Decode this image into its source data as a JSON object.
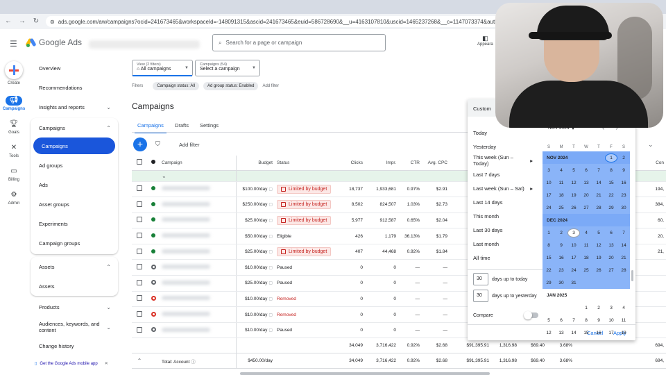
{
  "browser": {
    "url": "ads.google.com/aw/campaigns?ocid=241673465&workspaceId=-148091315&ascid=241673465&euid=586728690&__u=4163107810&uscid=1465237268&__c=1147073374&authuser=0&subid="
  },
  "app": {
    "name": "Google Ads",
    "search_placeholder": "Search for a page or campaign",
    "appearance_label": "Appeara"
  },
  "rail": {
    "create": "Create",
    "campaigns": "Campaigns",
    "goals": "Goals",
    "tools": "Tools",
    "billing": "Billing",
    "admin": "Admin"
  },
  "sidenav": {
    "overview": "Overview",
    "recommendations": "Recommendations",
    "insights": "Insights and reports",
    "campaigns_section": "Campaigns",
    "campaigns": "Campaigns",
    "ad_groups": "Ad groups",
    "ads": "Ads",
    "asset_groups": "Asset groups",
    "experiments": "Experiments",
    "campaign_groups": "Campaign groups",
    "assets_section": "Assets",
    "assets": "Assets",
    "products": "Products",
    "audiences": "Audiences, keywords, and content",
    "change_history": "Change history",
    "mobile_app": "Get the Google Ads mobile app"
  },
  "toolbar": {
    "view_sub": "View (2 filters)",
    "view_label": "All campaigns",
    "campaigns_sub": "Campaigns (54)",
    "campaigns_label": "Select a campaign",
    "filters_label": "Filters",
    "chip1": "Campaign status: All",
    "chip2": "Ad group status: Enabled",
    "add_filter_small": "Add filter",
    "page_title": "Campaigns",
    "tabs": [
      "Campaigns",
      "Drafts",
      "Settings"
    ],
    "add_filter": "Add filter"
  },
  "table": {
    "headers": {
      "campaign": "Campaign",
      "budget": "Budget",
      "status": "Status",
      "clicks": "Clicks",
      "impr": "Impr.",
      "ctr": "CTR",
      "avg_cpc": "Avg. CPC",
      "conv": "Con"
    },
    "rows": [
      {
        "state": "enabled",
        "budget": "$100.00/day",
        "status": "Limited by budget",
        "clicks": "18,737",
        "impr": "1,933,681",
        "ctr": "0.97%",
        "cpc": "$2.91",
        "right": "194,"
      },
      {
        "state": "enabled",
        "budget": "$250.00/day",
        "status": "Limited by budget",
        "clicks": "8,502",
        "impr": "824,507",
        "ctr": "1.03%",
        "cpc": "$2.73",
        "right": "384,"
      },
      {
        "state": "enabled",
        "budget": "$25.00/day",
        "status": "Limited by budget",
        "clicks": "5,977",
        "impr": "912,587",
        "ctr": "0.65%",
        "cpc": "$2.04",
        "right": "60,"
      },
      {
        "state": "enabled",
        "budget": "$50.00/day",
        "status": "Eligible",
        "clicks": "426",
        "impr": "1,179",
        "ctr": "36.13%",
        "cpc": "$1.79",
        "right": "20,"
      },
      {
        "state": "enabled",
        "budget": "$25.00/day",
        "status": "Limited by budget",
        "clicks": "407",
        "impr": "44,468",
        "ctr": "0.92%",
        "cpc": "$1.84",
        "right": "21,"
      },
      {
        "state": "paused",
        "budget": "$10.00/day",
        "status": "Paused",
        "clicks": "0",
        "impr": "0",
        "ctr": "—",
        "cpc": "—",
        "right": ""
      },
      {
        "state": "paused",
        "budget": "$25.00/day",
        "status": "Paused",
        "clicks": "0",
        "impr": "0",
        "ctr": "—",
        "cpc": "—",
        "right": ""
      },
      {
        "state": "removed",
        "budget": "$10.00/day",
        "status": "Removed",
        "clicks": "0",
        "impr": "0",
        "ctr": "—",
        "cpc": "—",
        "right": ""
      },
      {
        "state": "removed",
        "budget": "$10.00/day",
        "status": "Removed",
        "clicks": "0",
        "impr": "0",
        "ctr": "—",
        "cpc": "—",
        "right": ""
      },
      {
        "state": "paused",
        "budget": "$10.00/day",
        "status": "Paused",
        "clicks": "0",
        "impr": "0",
        "ctr": "—",
        "cpc": "—",
        "right": ""
      }
    ],
    "subtotal": {
      "clicks": "34,049",
      "impr": "3,716,422",
      "ctr": "0.92%",
      "cpc": "$2.68",
      "cost": "$91,395.91",
      "conv": "1,316.98",
      "cpa": "$69.40",
      "rate": "3.68%",
      "right": "694,"
    },
    "total": {
      "label": "Total: Account",
      "budget": "$450.00/day",
      "clicks": "34,049",
      "impr": "3,716,422",
      "ctr": "0.92%",
      "cpc": "$2.68",
      "cost": "$91,395.91",
      "conv": "1,316.98",
      "cpa": "$69.40",
      "rate": "3.68%",
      "right": "694,"
    }
  },
  "datepicker": {
    "custom": "Custom",
    "presets": [
      "Today",
      "Yesterday",
      "This week (Sun – Today)",
      "Last 7 days",
      "Last week (Sun – Sat)",
      "Last 14 days",
      "This month",
      "Last 30 days",
      "Last month",
      "All time"
    ],
    "days_to_today_value": "30",
    "days_to_today_label": "days up to today",
    "days_to_yesterday_value": "30",
    "days_to_yesterday_label": "days up to yesterday",
    "compare": "Compare",
    "cancel": "Cancel",
    "apply": "Apply",
    "month_select": "NOV 2024",
    "dow": [
      "S",
      "M",
      "T",
      "W",
      "T",
      "F",
      "S"
    ],
    "months": [
      {
        "label": "NOV 2024",
        "weeks": [
          [
            "",
            "",
            "",
            "",
            "",
            "1",
            "2"
          ],
          [
            "3",
            "4",
            "5",
            "6",
            "7",
            "8",
            "9"
          ],
          [
            "10",
            "11",
            "12",
            "13",
            "14",
            "15",
            "16"
          ],
          [
            "17",
            "18",
            "19",
            "20",
            "21",
            "22",
            "23"
          ],
          [
            "24",
            "25",
            "26",
            "27",
            "28",
            "29",
            "30"
          ]
        ]
      },
      {
        "label": "DEC 2024",
        "weeks": [
          [
            "1",
            "2",
            "3",
            "4",
            "5",
            "6",
            "7"
          ],
          [
            "8",
            "9",
            "10",
            "11",
            "12",
            "13",
            "14"
          ],
          [
            "15",
            "16",
            "17",
            "18",
            "19",
            "20",
            "21"
          ],
          [
            "22",
            "23",
            "24",
            "25",
            "26",
            "27",
            "28"
          ],
          [
            "29",
            "30",
            "31",
            "",
            "",
            "",
            ""
          ]
        ]
      },
      {
        "label": "JAN 2025",
        "weeks": [
          [
            "",
            "",
            "",
            "1",
            "2",
            "3",
            "4"
          ],
          [
            "5",
            "6",
            "7",
            "8",
            "9",
            "10",
            "11"
          ],
          [
            "12",
            "13",
            "14",
            "15",
            "16",
            "17",
            "18"
          ]
        ]
      }
    ]
  }
}
